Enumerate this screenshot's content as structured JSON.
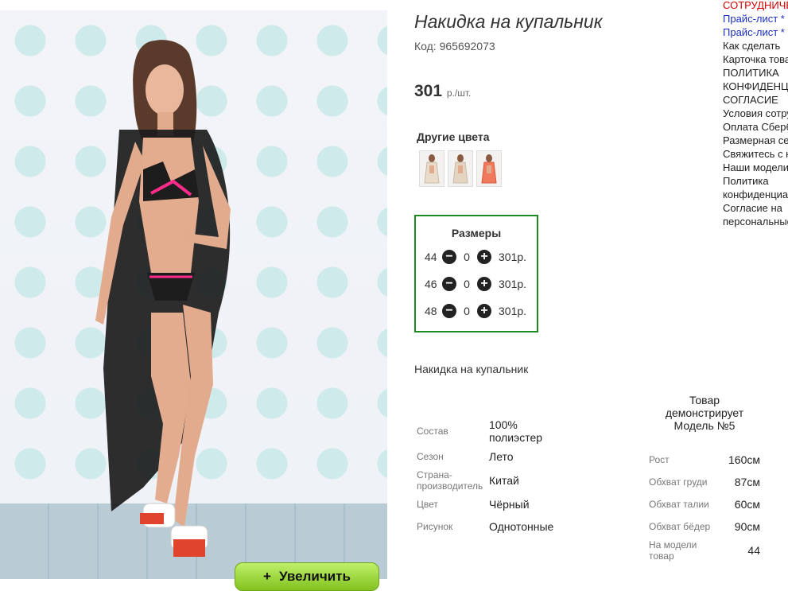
{
  "product": {
    "title": "Накидка на купальник",
    "code": "Код: 965692073",
    "price": "301",
    "price_unit": "р./шт.",
    "zoom_label": "Увеличить",
    "zoom_icon": "+"
  },
  "colors": {
    "title": "Другие цвета",
    "thumbs": [
      {
        "color": "#e6d9c9"
      },
      {
        "color": "#e2d3c4"
      },
      {
        "color": "#f08060"
      }
    ]
  },
  "sizes": {
    "title": "Размеры",
    "rows": [
      {
        "size": "44",
        "qty": "0",
        "price": "301р."
      },
      {
        "size": "46",
        "qty": "0",
        "price": "301р."
      },
      {
        "size": "48",
        "qty": "0",
        "price": "301р."
      }
    ]
  },
  "description": "Накидка на купальник",
  "properties": [
    {
      "label": "Состав",
      "value": "100% полиэстер"
    },
    {
      "label": "Сезон",
      "value": "Лето"
    },
    {
      "label": "Страна-производитель",
      "value": "Китай"
    },
    {
      "label": "Цвет",
      "value": "Чёрный"
    },
    {
      "label": "Рисунок",
      "value": "Однотонные"
    }
  ],
  "model": {
    "title": "Товар демонстрирует Модель №5",
    "rows": [
      {
        "label": "Рост",
        "value": "160см"
      },
      {
        "label": "Обхват груди",
        "value": "87см"
      },
      {
        "label": "Обхват талии",
        "value": "60см"
      },
      {
        "label": "Обхват бёдер",
        "value": "90см"
      },
      {
        "label": "На модели товар",
        "value": "44"
      }
    ]
  },
  "side_menu": [
    {
      "label": "СОТРУДНИЧЕСТВО",
      "color": "#d00000"
    },
    {
      "label": "Прайс-лист *",
      "color": "#1a2fc0"
    },
    {
      "label": "Прайс-лист *",
      "color": "#1a2fc0"
    },
    {
      "label": "Как сделать",
      "color": "#222222"
    },
    {
      "label": "Карточка товара",
      "color": "#222222"
    },
    {
      "label": "ПОЛИТИКА",
      "color": "#222222"
    },
    {
      "label": "КОНФИДЕНЦИАЛЬНОСТИ",
      "color": "#222222"
    },
    {
      "label": "СОГЛАСИЕ",
      "color": "#222222"
    },
    {
      "label": "Условия сотрудничества",
      "color": "#222222"
    },
    {
      "label": "Оплата Сбербанк",
      "color": "#222222"
    },
    {
      "label": "Размерная сетка",
      "color": "#222222"
    },
    {
      "label": "Свяжитесь с нами",
      "color": "#222222"
    },
    {
      "label": "Наши модели",
      "color": "#222222"
    },
    {
      "label": "Политика",
      "color": "#222222"
    },
    {
      "label": "конфиденциальности",
      "color": "#222222"
    },
    {
      "label": "Согласие на",
      "color": "#222222"
    },
    {
      "label": "персональные",
      "color": "#222222"
    }
  ]
}
